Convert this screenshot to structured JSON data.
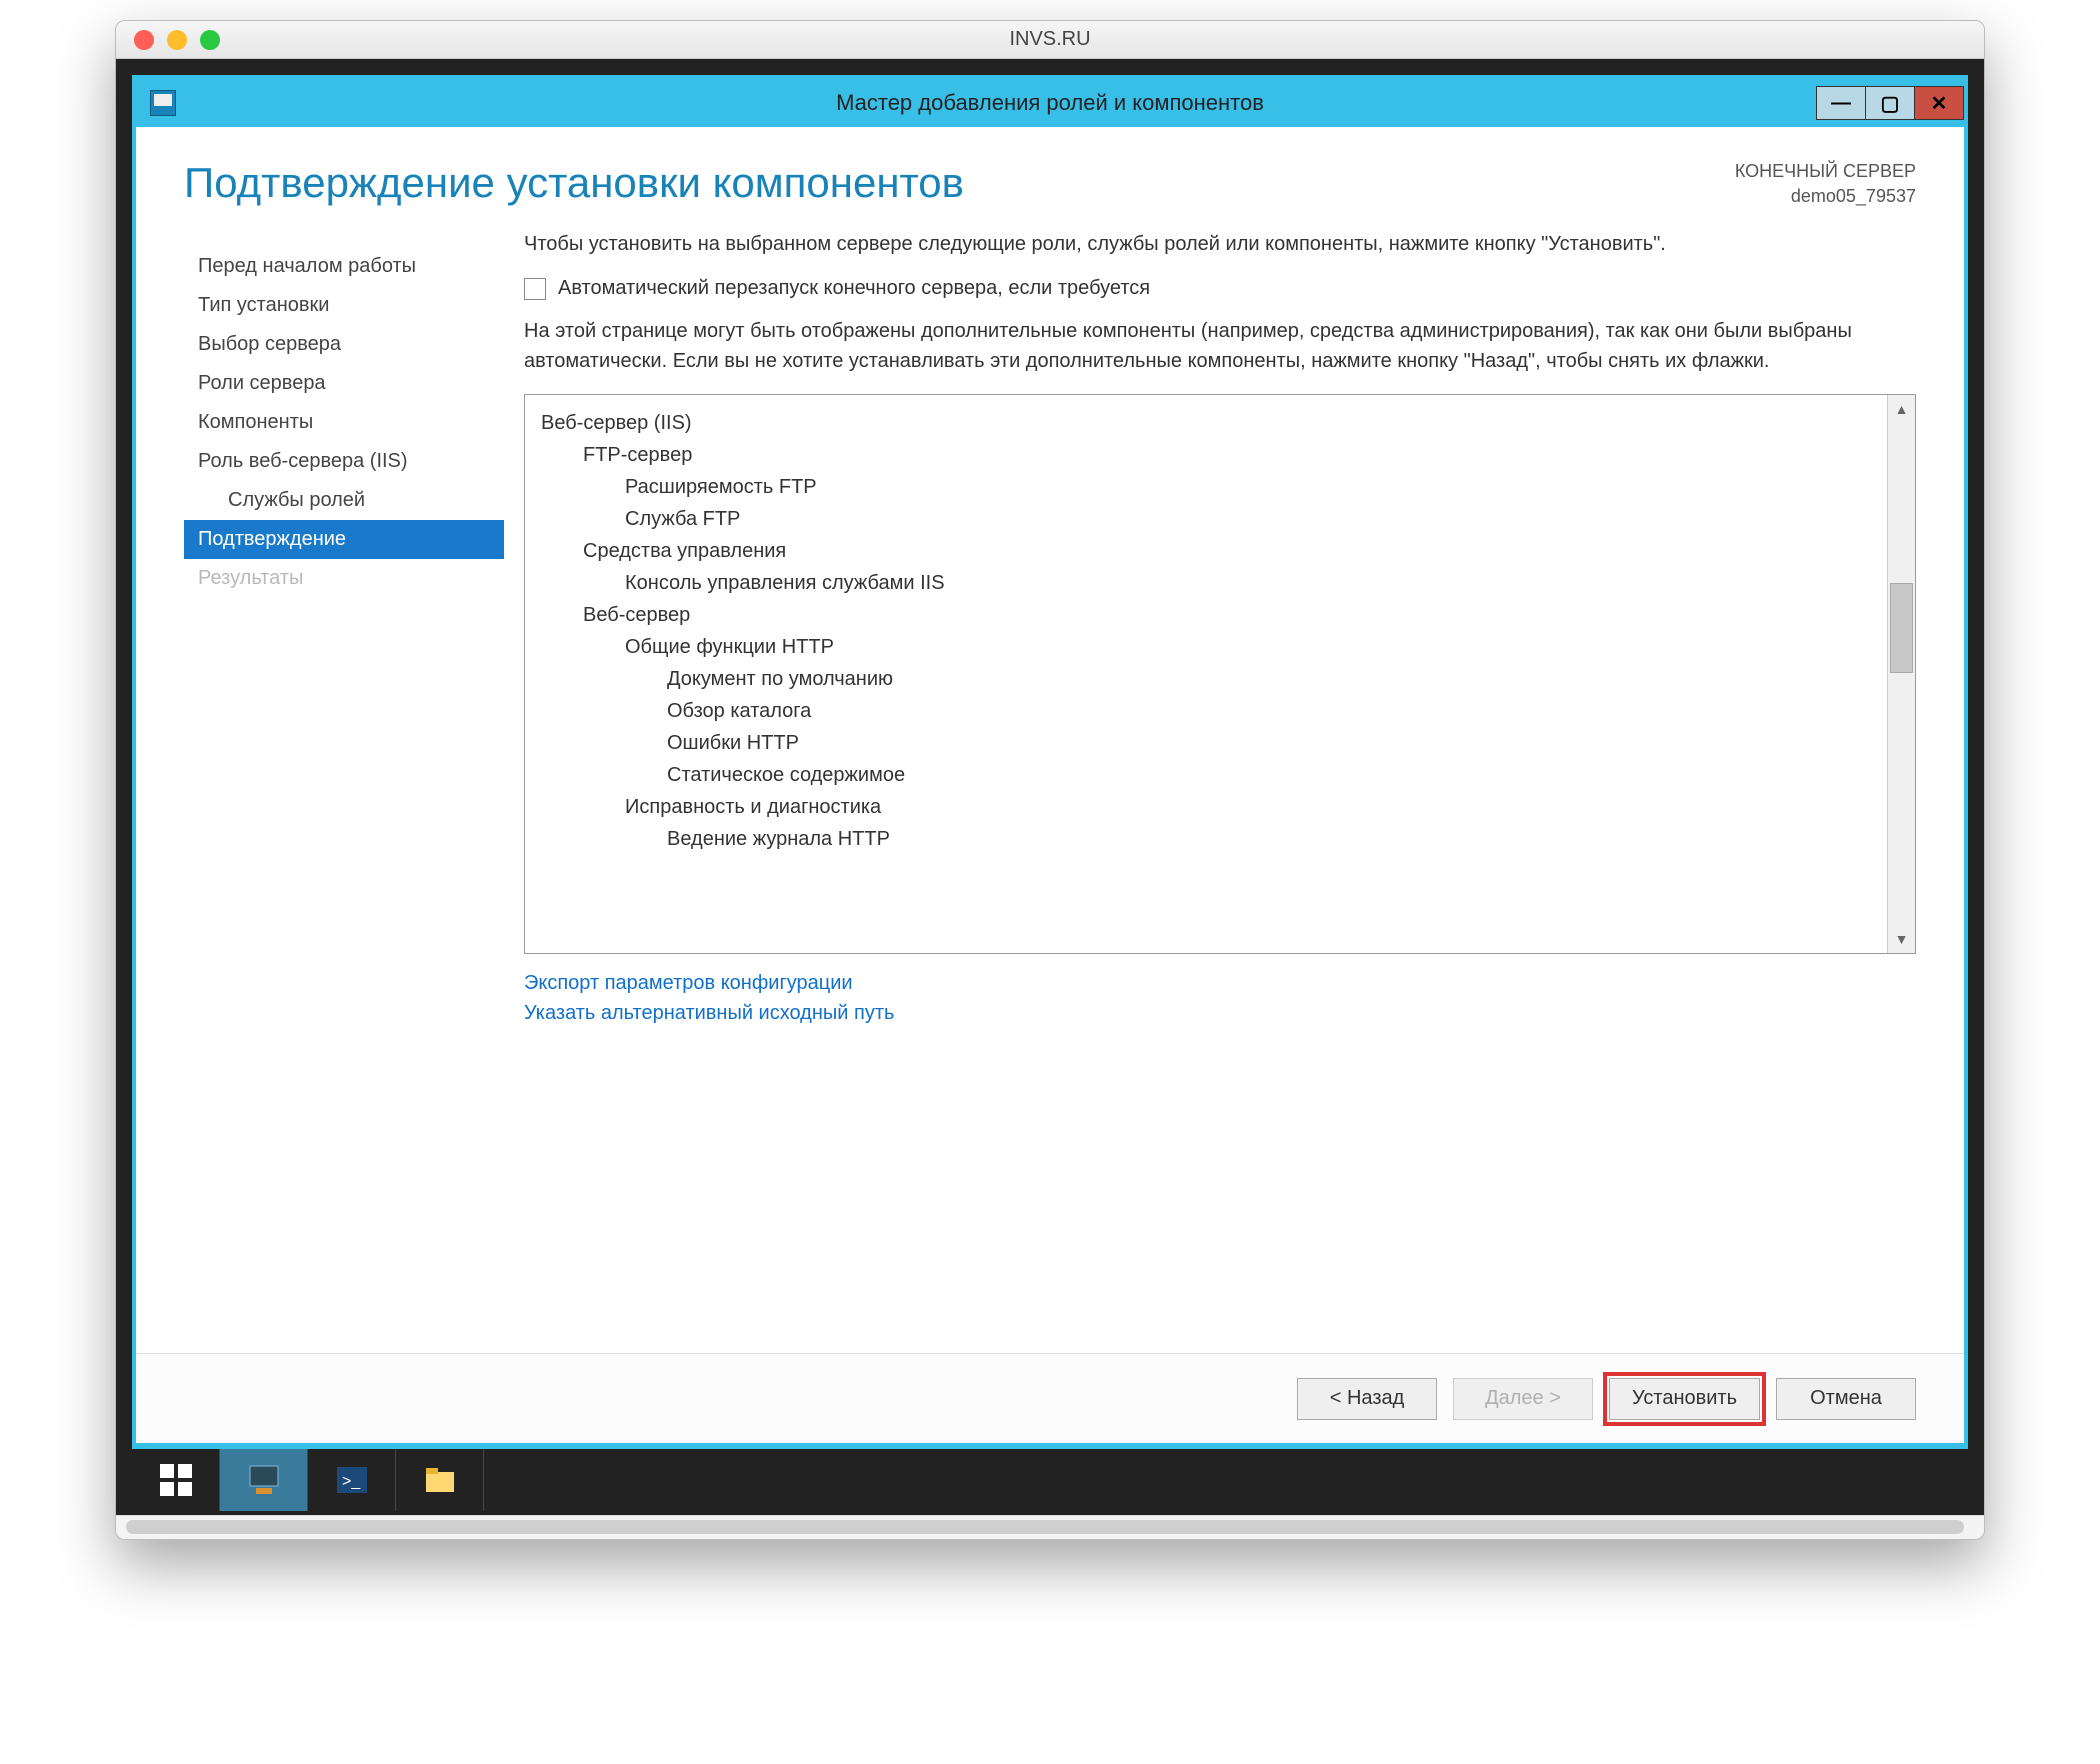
{
  "mac": {
    "title": "INVS.RU"
  },
  "wizard": {
    "title": "Мастер добавления ролей и компонентов",
    "heading": "Подтверждение установки компонентов",
    "target_label": "КОНЕЧНЫЙ СЕРВЕР",
    "target_server": "demo05_79537",
    "intro": "Чтобы установить на выбранном сервере следующие роли, службы ролей или компоненты, нажмите кнопку \"Установить\".",
    "checkbox_label": "Автоматический перезапуск конечного сервера, если требуется",
    "note": "На этой странице могут быть отображены дополнительные компоненты (например, средства администрирования), так как они были выбраны автоматически. Если вы не хотите устанавливать эти дополнительные компоненты, нажмите кнопку \"Назад\", чтобы снять их флажки.",
    "nav": [
      {
        "label": "Перед началом работы",
        "state": "normal"
      },
      {
        "label": "Тип установки",
        "state": "normal"
      },
      {
        "label": "Выбор сервера",
        "state": "normal"
      },
      {
        "label": "Роли сервера",
        "state": "normal"
      },
      {
        "label": "Компоненты",
        "state": "normal"
      },
      {
        "label": "Роль веб-сервера (IIS)",
        "state": "normal"
      },
      {
        "label": "Службы ролей",
        "state": "sub"
      },
      {
        "label": "Подтверждение",
        "state": "active"
      },
      {
        "label": "Результаты",
        "state": "disabled"
      }
    ],
    "tree": [
      {
        "level": 1,
        "text": "Веб-сервер (IIS)"
      },
      {
        "level": 2,
        "text": "FTP-сервер"
      },
      {
        "level": 3,
        "text": "Расширяемость FTP"
      },
      {
        "level": 3,
        "text": "Служба FTP"
      },
      {
        "level": 2,
        "text": "Средства управления"
      },
      {
        "level": 3,
        "text": "Консоль управления службами IIS"
      },
      {
        "level": 2,
        "text": "Веб-сервер"
      },
      {
        "level": 3,
        "text": "Общие функции HTTP"
      },
      {
        "level": 4,
        "text": "Документ по умолчанию"
      },
      {
        "level": 4,
        "text": "Обзор каталога"
      },
      {
        "level": 4,
        "text": "Ошибки HTTP"
      },
      {
        "level": 4,
        "text": "Статическое содержимое"
      },
      {
        "level": 3,
        "text": "Исправность и диагностика"
      },
      {
        "level": 4,
        "text": "Ведение журнала HTTP"
      }
    ],
    "links": {
      "export": "Экспорт параметров конфигурации",
      "altpath": "Указать альтернативный исходный путь"
    },
    "buttons": {
      "back": "< Назад",
      "next": "Далее >",
      "install": "Установить",
      "cancel": "Отмена"
    }
  }
}
